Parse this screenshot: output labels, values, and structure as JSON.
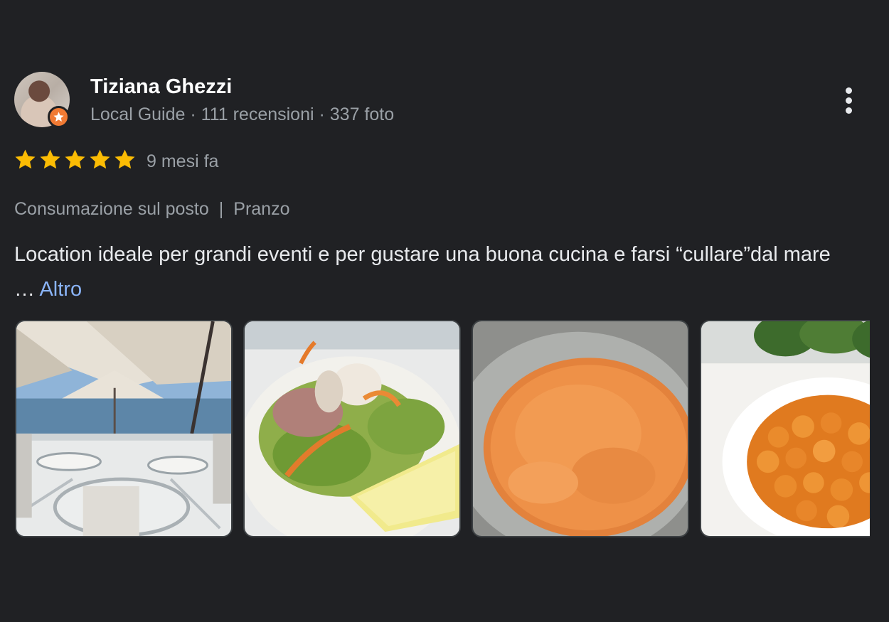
{
  "reviewer": {
    "name": "Tiziana Ghezzi",
    "meta": "Local Guide · 111 recensioni · 337 foto"
  },
  "review": {
    "rating": 5,
    "rating_max": 5,
    "time": "9 mesi fa",
    "tag_service": "Consumazione sul posto",
    "tag_separator": "|",
    "tag_meal": "Pranzo",
    "text": "Location ideale per grandi eventi e per gustare una buona cucina e farsi “cullare”dal mare … ",
    "more_label": "Altro"
  },
  "icons": {
    "menu": "more-vert-icon",
    "star": "star-icon",
    "badge": "local-guide-badge-icon"
  },
  "colors": {
    "background": "#202124",
    "star": "#fbbc04",
    "link": "#8ab4f8",
    "badge": "#f07a34",
    "secondary_text": "#9aa0a6"
  }
}
